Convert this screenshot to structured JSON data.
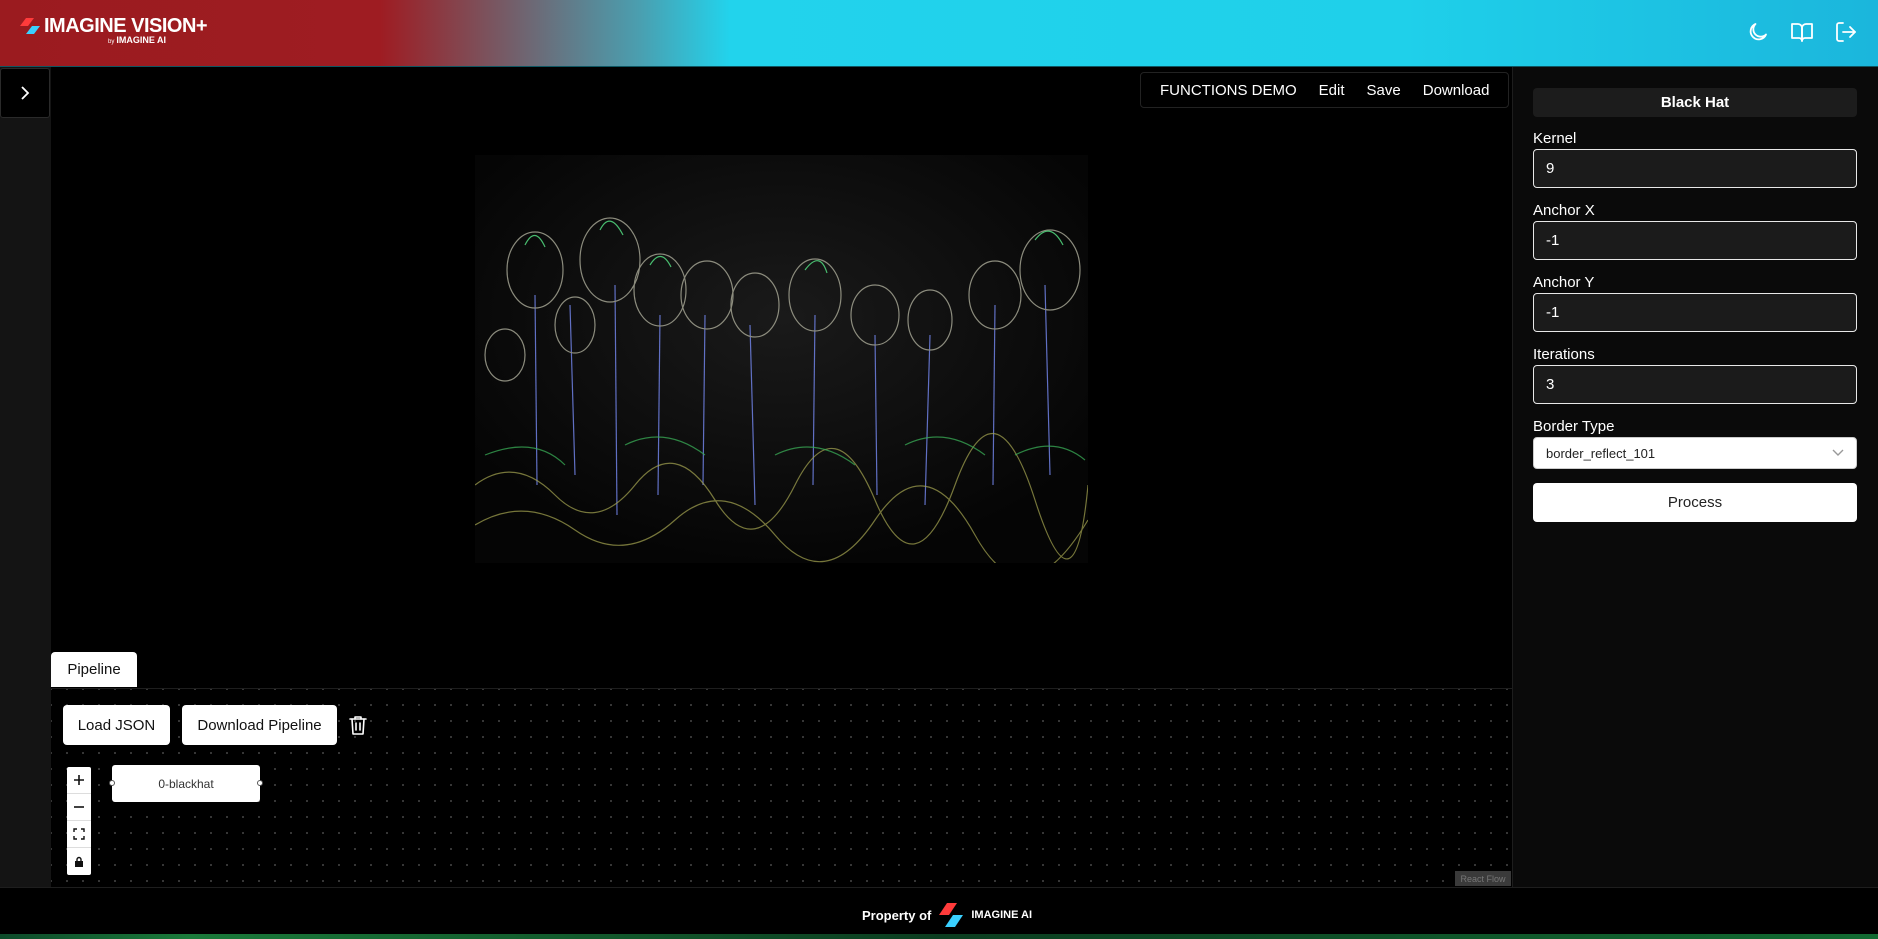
{
  "header": {
    "logo_title": "IMAGINE VISION+",
    "logo_by": "by",
    "logo_company": "IMAGINE AI",
    "icons": [
      "moon-icon",
      "book-icon",
      "logout-icon"
    ]
  },
  "menu": {
    "demo_label": "FUNCTIONS DEMO",
    "edit_label": "Edit",
    "save_label": "Save",
    "download_label": "Download"
  },
  "pipeline": {
    "tab_label": "Pipeline",
    "load_json_label": "Load JSON",
    "download_pipeline_label": "Download Pipeline",
    "node_label": "0-blackhat",
    "attribution": "React Flow"
  },
  "panel": {
    "title": "Black Hat",
    "kernel_label": "Kernel",
    "kernel_value": "9",
    "anchor_x_label": "Anchor X",
    "anchor_x_value": "-1",
    "anchor_y_label": "Anchor Y",
    "anchor_y_value": "-1",
    "iterations_label": "Iterations",
    "iterations_value": "3",
    "border_type_label": "Border Type",
    "border_type_value": "border_reflect_101",
    "process_label": "Process"
  },
  "footer": {
    "property_text": "Property of",
    "logo_text": "IMAGINE AI"
  },
  "colors": {
    "header_red": "#9b1b1f",
    "header_cyan": "#22d3ec",
    "panel_bg": "#0a0a0a"
  }
}
